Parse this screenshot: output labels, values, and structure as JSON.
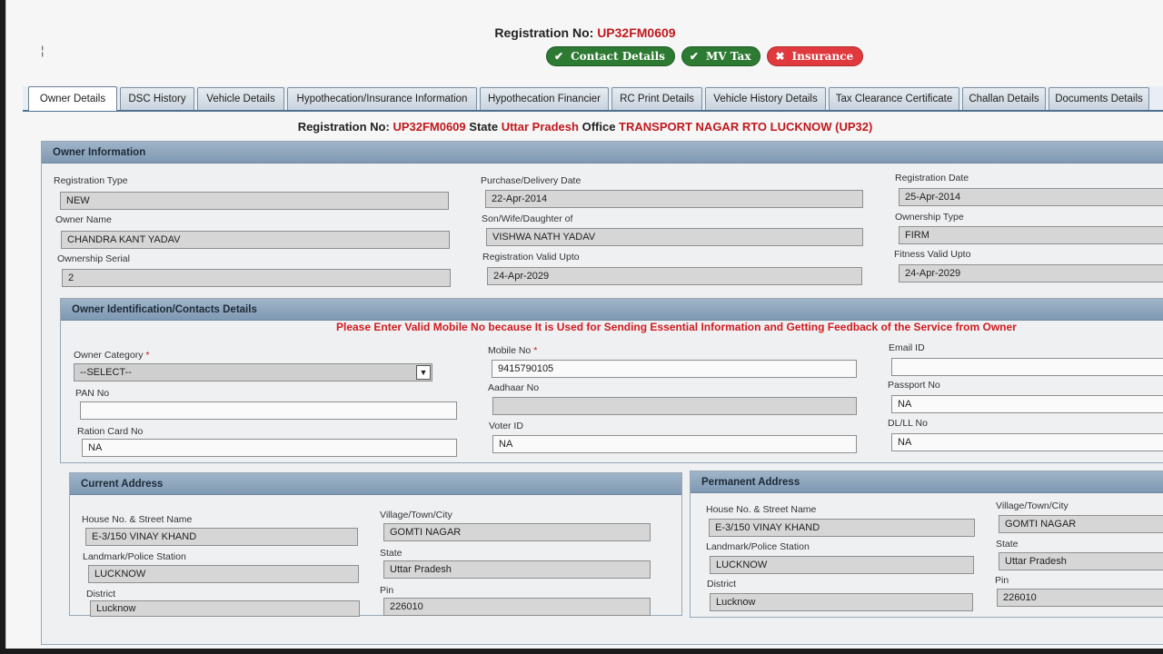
{
  "header": {
    "reg_label": "Registration No:",
    "reg_no": "UP32FM0609"
  },
  "status_buttons": [
    {
      "label": "Contact Details",
      "icon": "check-icon",
      "color": "#2d7a32"
    },
    {
      "label": "MV Tax",
      "icon": "check-icon",
      "color": "#2d7a32"
    },
    {
      "label": "Insurance",
      "icon": "cross-icon",
      "color": "#e03a3e"
    }
  ],
  "tabs": [
    {
      "label": "Owner Details",
      "active": true
    },
    {
      "label": "DSC History"
    },
    {
      "label": "Vehicle Details"
    },
    {
      "label": "Hypothecation/Insurance Information"
    },
    {
      "label": "Hypothecation Financier"
    },
    {
      "label": "RC Print Details"
    },
    {
      "label": "Vehicle History Details"
    },
    {
      "label": "Tax Clearance Certificate"
    },
    {
      "label": "Challan Details"
    },
    {
      "label": "Documents Details"
    }
  ],
  "reg_line": {
    "reg_label": "Registration No:",
    "reg_no": "UP32FM0609",
    "state_label": "State",
    "state": "Uttar Pradesh",
    "office_label": "Office",
    "office": "TRANSPORT NAGAR RTO LUCKNOW (UP32)"
  },
  "owner_info": {
    "title": "Owner Information",
    "registration_type_label": "Registration Type",
    "registration_type": "NEW",
    "purchase_date_label": "Purchase/Delivery Date",
    "purchase_date": "22-Apr-2014",
    "registration_date_label": "Registration Date",
    "registration_date": "25-Apr-2014",
    "owner_name_label": "Owner Name",
    "owner_name": "CHANDRA KANT YADAV",
    "relation_label": "Son/Wife/Daughter of",
    "relation": "VISHWA NATH YADAV",
    "ownership_type_label": "Ownership Type",
    "ownership_type": "FIRM",
    "ownership_serial_label": "Ownership Serial",
    "ownership_serial": "2",
    "reg_valid_label": "Registration Valid Upto",
    "reg_valid": "24-Apr-2029",
    "fitness_valid_label": "Fitness Valid Upto",
    "fitness_valid": "24-Apr-2029"
  },
  "contacts": {
    "title": "Owner Identification/Contacts Details",
    "warning": "Please Enter Valid Mobile No because It is Used for Sending Essential Information and Getting Feedback of the Service from Owner",
    "owner_category_label": "Owner Category",
    "owner_category": "--SELECT--",
    "mobile_label": "Mobile No",
    "mobile": "9415790105",
    "email_label": "Email ID",
    "email": "",
    "pan_label": "PAN No",
    "pan": "",
    "aadhaar_label": "Aadhaar No",
    "aadhaar": "",
    "passport_label": "Passport No",
    "passport": "NA",
    "ration_label": "Ration Card No",
    "ration": "NA",
    "voter_label": "Voter ID",
    "voter": "NA",
    "dl_label": "DL/LL No",
    "dl": "NA",
    "req_mark": "*"
  },
  "current_address": {
    "title": "Current Address",
    "house_label": "House No. & Street Name",
    "house": "E-3/150 VINAY KHAND",
    "village_label": "Village/Town/City",
    "village": "GOMTI NAGAR",
    "landmark_label": "Landmark/Police Station",
    "landmark": "LUCKNOW",
    "state_label": "State",
    "state": "Uttar Pradesh",
    "district_label": "District",
    "district": "Lucknow",
    "pin_label": "Pin",
    "pin": "226010"
  },
  "permanent_address": {
    "title": "Permanent Address",
    "house_label": "House No. & Street Name",
    "house": "E-3/150 VINAY KHAND",
    "village_label": "Village/Town/City",
    "village": "GOMTI NAGAR",
    "landmark_label": "Landmark/Police Station",
    "landmark": "LUCKNOW",
    "state_label": "State",
    "state": "Uttar Pradesh",
    "district_label": "District",
    "district": "Lucknow",
    "pin_label": "Pin",
    "pin": "226010"
  }
}
